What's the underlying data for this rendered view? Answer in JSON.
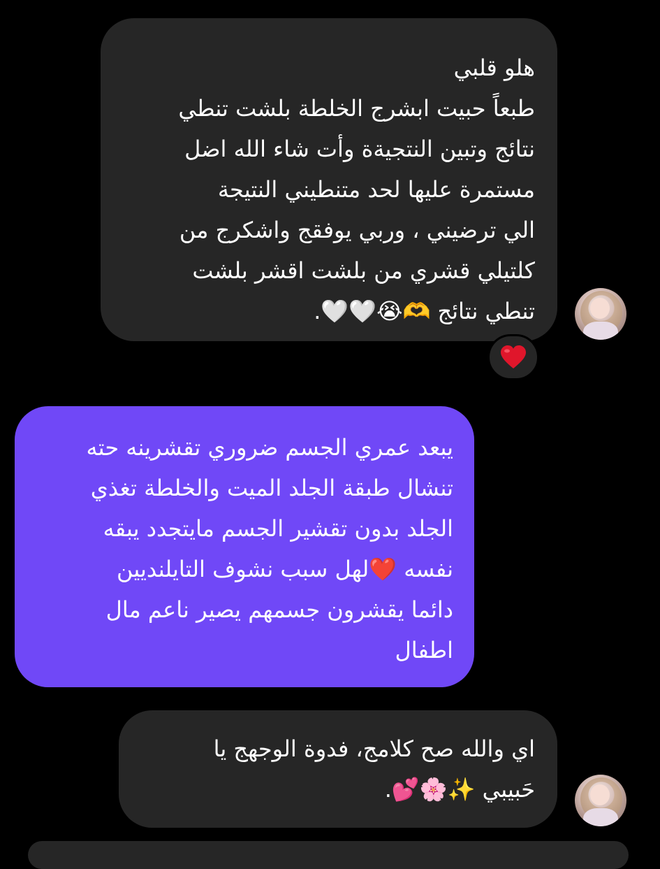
{
  "messages": [
    {
      "sender": "other",
      "lines": [
        "هلو قلبي",
        "طبعاً حبيت ابشرج الخلطة بلشت  تنطي",
        "نتائج وتبين النتجيةة وأت شاء الله اضل",
        "مستمرة عليها لحد متنطيني النتيجة",
        "الي ترضيني ، وربي يوفقج واشكرج من",
        "كلتيلي قشري من بلشت اقشر بلشت",
        "تنطي نتائج 🫶😭🤍🤍."
      ],
      "reaction": "❤️"
    },
    {
      "sender": "me",
      "lines": [
        "يبعد عمري الجسم ضروري تقشرينه حته",
        "تنشال طبقة الجلد الميت والخلطة تغذي",
        "الجلد بدون تقشير الجسم مايتجدد يبقه",
        "نفسه ❤️لهل سبب نشوف التايلنديين",
        "دائما يقشرون جسمهم يصير ناعم مال",
        "اطفال"
      ]
    },
    {
      "sender": "other",
      "lines": [
        "اي والله صح كلامج،  فدوة الوجهج يا",
        "حَبيبي ✨🌸💕."
      ]
    }
  ],
  "colors": {
    "background": "#000000",
    "incoming_bubble": "#262626",
    "outgoing_bubble": "#7048f7",
    "text": "#ffffff"
  }
}
